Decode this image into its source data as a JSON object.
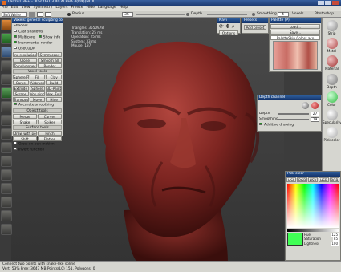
{
  "window": {
    "title": "Lanzu1 3b+ - 3D-COAT 3.40 ALPHA 4(DX)(NDX)"
  },
  "menu": [
    "File",
    "Edit",
    "View",
    "Symmetry",
    "Layers",
    "Freeze",
    "Hide",
    "Language",
    "Help"
  ],
  "toolbar": {
    "brush_value": "Soft White",
    "radius_label": "Radius",
    "value_36": "36",
    "depth_label": "Depth",
    "smoothing_label": "Smoothing",
    "smoothing_value": "4",
    "tab_label": "Voxels",
    "right_label": "Photoshop"
  },
  "stats": {
    "triangles": "Triangles: 3550978",
    "translation": "Translation: 25 ms",
    "operation": "Operation: 25 ms",
    "system": "System: 33 ms",
    "mouse": "Mouse: 137"
  },
  "voxel_panel": {
    "title": "Voxels: general sculpting tool",
    "shaders_label": "Shaders",
    "cast_shadows": "Cast shadows",
    "multicore": "Multicore",
    "show_info": "Show info",
    "incremental_render": "Incremental render",
    "use_cuda": "UseCUDA",
    "inc_resolution": "Inc resolution",
    "symm_copy": "Symm copy",
    "clone": "Clone",
    "smooth_all": "Smooth all",
    "to_polygones": "To polygones",
    "render": "Render",
    "voxel_tools_title": "Voxel tools",
    "tools": [
      [
        "Sphere/Pic",
        "Fill",
        "Clay"
      ],
      [
        "Carve",
        "Airbrush",
        "Build"
      ],
      [
        "Extrude",
        "Sphere",
        "3D-Paint"
      ],
      [
        "Scrape",
        "Vox pinch",
        "Vox. Follow"
      ],
      [
        "Transpose",
        "Move",
        "Hide"
      ]
    ],
    "accurate_smoothing": "Accurate smoothing",
    "object_tools_title": "Object tools",
    "object_tools": [
      [
        "Merge",
        "Curves"
      ],
      [
        "Snake",
        "Spikes"
      ]
    ],
    "surface_tools_title": "Surface tools",
    "surface_tools": [
      [
        "Draw with pen",
        "Pinch"
      ],
      [
        "Shift",
        "Flatten"
      ]
    ],
    "grow_on_pen": "Grow on pen motion",
    "invert": "Invert function"
  },
  "nav_panel": {
    "title": "Navi",
    "options_label": "Options"
  },
  "presets_panel": {
    "title": "Presets",
    "add_preset": "Add preset"
  },
  "palette_panel": {
    "title": "Palette (P)",
    "load": "Load...",
    "save": "Save...",
    "palette_name": "PaletteSkin Colors.aco"
  },
  "depth_channel": {
    "title": "Depth channel",
    "depth_label": "Depth",
    "depth_value": "27",
    "smoothing_label": "Smoothing",
    "smoothing_value": "19",
    "additive": "Additive drawing"
  },
  "right_column": {
    "items": [
      "Strip",
      "Metal",
      "Material",
      "Depth",
      "Color",
      "Specularity",
      "Pick color"
    ]
  },
  "pick_color": {
    "title": "Pick color",
    "tabs": [
      "HSL",
      "RGB",
      "HSV",
      "HSB",
      "RGB"
    ],
    "hue_label": "Hue",
    "hue_value": "125",
    "saturation_label": "Saturation",
    "saturation_value": "85",
    "lightness_label": "Lightness",
    "lightness_value": "100"
  },
  "status": {
    "hint": "Connect two points with snake-like spline",
    "stats": "Vert: 53% Free: 3647 MB Points(L0) 151, Polygons: 0"
  },
  "colors": {
    "sculpt": "#7a2320",
    "accent": "#2e5d9a",
    "swatch_a": "#40ff55",
    "swatch_b": "#2dba3f"
  }
}
